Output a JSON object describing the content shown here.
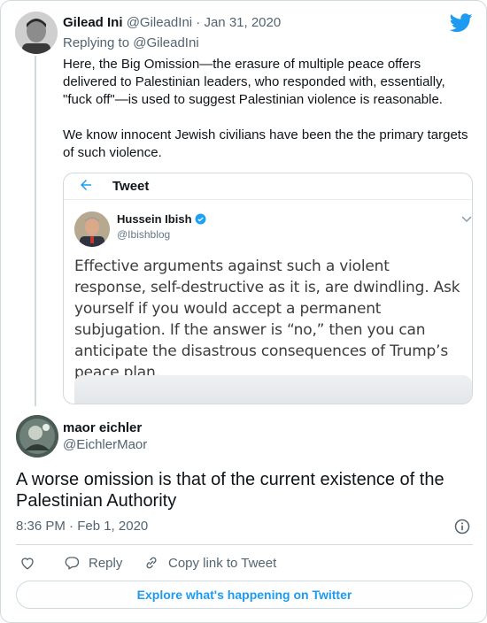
{
  "parent": {
    "name": "Gilead Ini",
    "handle": "@GileadIni",
    "separator": "·",
    "date": "Jan 31, 2020",
    "replying_prefix": "Replying to",
    "replying_mention": "@GileadIni",
    "paragraph1": "Here, the Big Omission—the erasure of multiple peace offers delivered to Palestinian leaders, who responded with, essentially, \"fuck off\"—is used to suggest Palestinian violence is reasonable.",
    "paragraph2": "We know innocent Jewish civilians have been the the primary targets of such violence."
  },
  "quote": {
    "header_title": "Tweet",
    "name": "Hussein Ibish",
    "handle": "@Ibishblog",
    "text": "Effective arguments against such a violent response, self-destructive as it is, are dwindling. Ask yourself if you would accept a permanent subjugation. If the answer is “no,” then you can anticipate the disastrous consequences of Trump’s peace plan."
  },
  "reply": {
    "name": "maor eichler",
    "handle": "@EichlerMaor",
    "text": "A worse omission is that of the current existence of the Palestinian Authority",
    "timestamp": "8:36 PM · Feb 1, 2020"
  },
  "actions": {
    "reply_label": "Reply",
    "copy_label": "Copy link to Tweet"
  },
  "explore_label": "Explore what's happening on Twitter",
  "colors": {
    "twitter_blue": "#1d9bf0",
    "text_primary": "#0f1419",
    "text_secondary": "#536471",
    "border": "#cfd9de"
  },
  "icons": [
    "twitter-logo-icon",
    "back-arrow-icon",
    "verified-badge-icon",
    "chevron-down-icon",
    "info-icon",
    "heart-icon",
    "reply-icon",
    "link-icon"
  ]
}
